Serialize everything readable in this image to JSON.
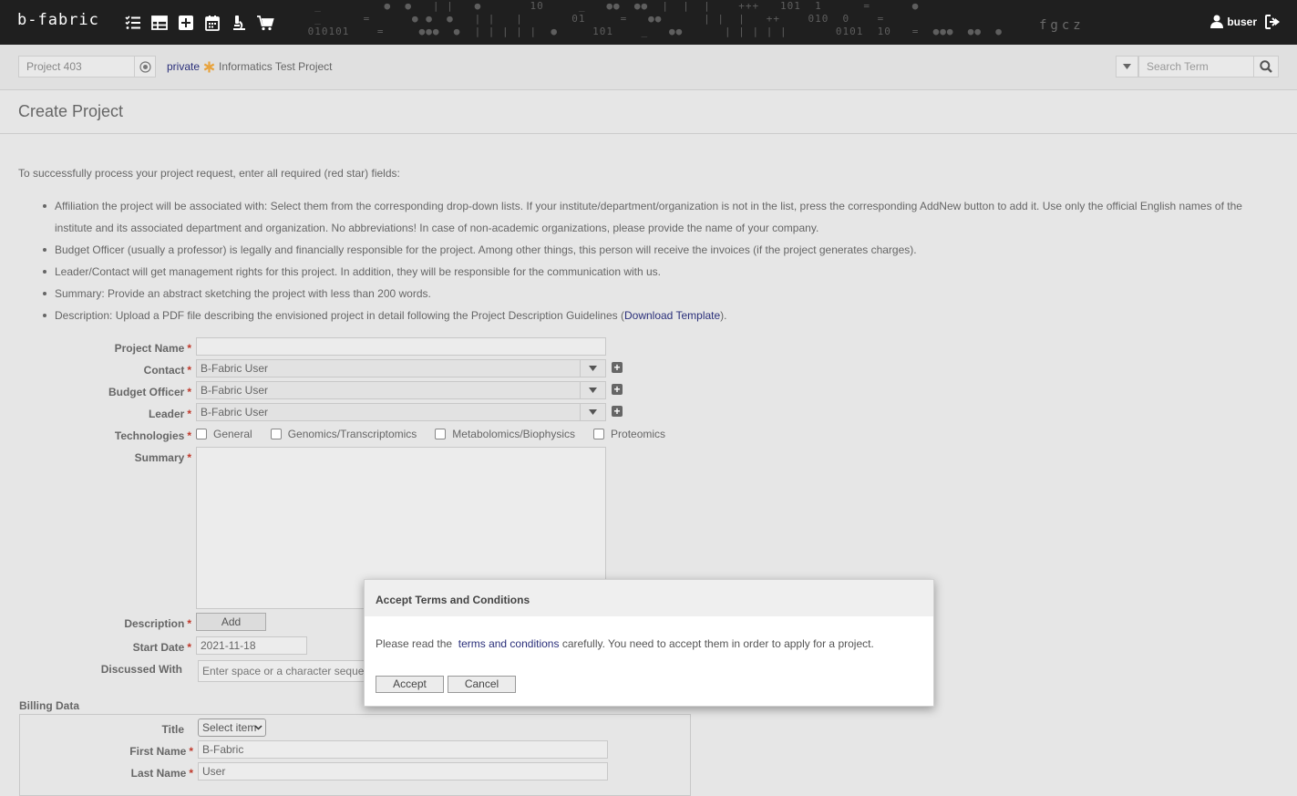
{
  "app": {
    "logo": "b-fabric",
    "fgcz": "fgcz",
    "username": "buser"
  },
  "nav_icons": [
    "list-check-icon",
    "table-icon",
    "plus-square-icon",
    "calendar-icon",
    "microscope-icon",
    "shopping-cart-icon"
  ],
  "project_bar": {
    "project_value": "Project 403",
    "visibility": "private",
    "project_name": "Informatics Test Project",
    "search_placeholder": "Search Term"
  },
  "page": {
    "title": "Create Project",
    "intro": "To successfully process your project request, enter all required (red star) fields:",
    "bullets": {
      "b1": "Affiliation the project will be associated with: Select them from the corresponding drop-down lists. If your institute/department/organization is not in the list, press the corresponding AddNew button to add it. Use only the official English names of the institute and its associated department and organization. No abbreviations! In case of non-academic organizations, please provide the name of your company.",
      "b2": "Budget Officer (usually a professor) is legally and financially responsible for the project. Among other things, this person will receive the invoices (if the project generates charges).",
      "b3": "Leader/Contact will get management rights for this project. In addition, they will be responsible for the communication with us.",
      "b4": "Summary: Provide an abstract sketching the project with less than 200 words.",
      "b5_pre": "Description: Upload a PDF file describing the envisioned project in detail following the Project Description Guidelines (",
      "b5_link": "Download Template",
      "b5_post": ")."
    }
  },
  "form": {
    "project_name_label": "Project Name",
    "project_name_value": "",
    "contact_label": "Contact",
    "contact_value": "B-Fabric User",
    "budget_officer_label": "Budget Officer",
    "budget_officer_value": "B-Fabric User",
    "leader_label": "Leader",
    "leader_value": "B-Fabric User",
    "technologies_label": "Technologies",
    "technologies": [
      "General",
      "Genomics/Transcriptomics",
      "Metabolomics/Biophysics",
      "Proteomics"
    ],
    "summary_label": "Summary",
    "description_label": "Description",
    "add_button": "Add",
    "start_date_label": "Start Date",
    "start_date_value": "2021-11-18",
    "discussed_with_label": "Discussed With",
    "discussed_with_placeholder": "Enter space or a character sequence"
  },
  "billing": {
    "title": "Billing Data",
    "title_label": "Title",
    "title_select": "Select item",
    "first_name_label": "First Name",
    "first_name_value": "B-Fabric",
    "last_name_label": "Last Name",
    "last_name_value": "User"
  },
  "modal": {
    "title": "Accept Terms and Conditions",
    "text_pre": "Please read the",
    "link": "terms and conditions",
    "text_post": "carefully. You need to accept them in order to apply for a project.",
    "accept": "Accept",
    "cancel": "Cancel"
  },
  "colors": {
    "link": "#2a2f7a",
    "required": "#c0392b",
    "private_star": "#e8a33d",
    "topbar": "#1f1f1f"
  }
}
